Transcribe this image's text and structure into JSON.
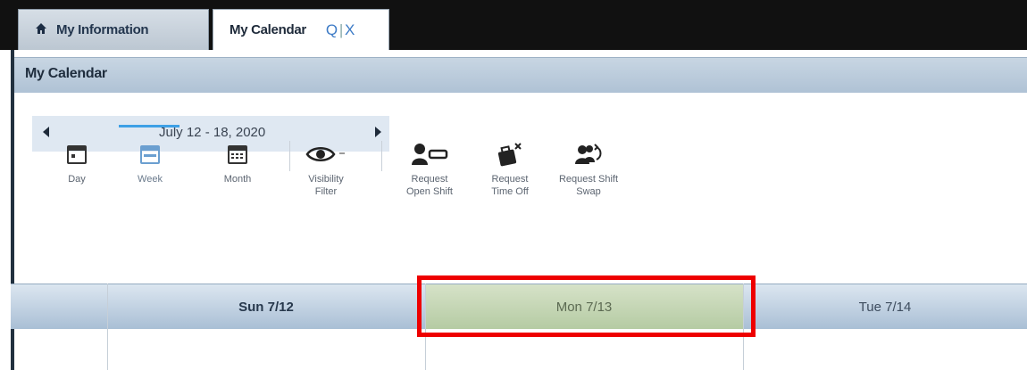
{
  "tabs": [
    {
      "label": "My Information",
      "icon": "home-icon"
    },
    {
      "label": "My Calendar",
      "actions": [
        "search-icon",
        "close-icon"
      ],
      "search_glyph": "Q",
      "close_glyph": "X"
    }
  ],
  "panel": {
    "title": "My Calendar"
  },
  "date_nav": {
    "range": "July 12 - 18, 2020"
  },
  "toolbar": {
    "day": "Day",
    "week": "Week",
    "month": "Month",
    "visibility": "Visibility Filter",
    "open_shift": "Request Open Shift",
    "time_off": "Request Time Off",
    "shift_swap": "Request Shift Swap",
    "selected": "Week"
  },
  "calendar": {
    "columns": [
      "Sun 7/12",
      "Mon 7/13",
      "Tue 7/14"
    ],
    "highlighted": "Mon 7/13"
  },
  "colors": {
    "accent": "#3ea0e6",
    "header_bar": "#afc2d5",
    "highlight_column": "#c3d6b1",
    "annotation_box": "#ee0000"
  }
}
